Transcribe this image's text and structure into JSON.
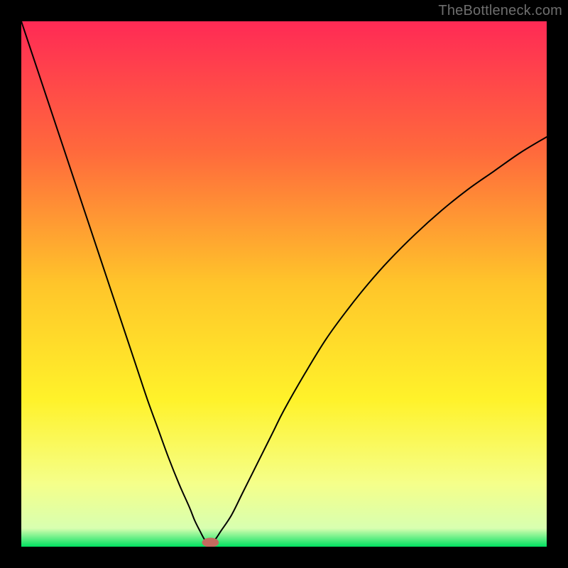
{
  "watermark": "TheBottleneck.com",
  "chart_data": {
    "type": "line",
    "title": "",
    "xlabel": "",
    "ylabel": "",
    "xlim": [
      0,
      100
    ],
    "ylim": [
      0,
      100
    ],
    "grid": false,
    "legend": false,
    "background_gradient": {
      "stops": [
        {
          "offset": 0.0,
          "color": "#ff2a55"
        },
        {
          "offset": 0.25,
          "color": "#ff6a3c"
        },
        {
          "offset": 0.5,
          "color": "#ffc52a"
        },
        {
          "offset": 0.72,
          "color": "#fff22a"
        },
        {
          "offset": 0.88,
          "color": "#f5ff8a"
        },
        {
          "offset": 0.965,
          "color": "#d8ffb0"
        },
        {
          "offset": 1.0,
          "color": "#00e060"
        }
      ]
    },
    "series": [
      {
        "name": "left-branch",
        "x": [
          0,
          2,
          4,
          6,
          8,
          10,
          12,
          14,
          16,
          18,
          20,
          22,
          24,
          26,
          28,
          30,
          32,
          33,
          34,
          35,
          36
        ],
        "values": [
          100,
          94,
          88,
          82,
          76,
          70,
          64,
          58,
          52,
          46,
          40,
          34,
          28,
          22.5,
          17,
          12,
          7.5,
          5,
          3,
          1.2,
          0.5
        ]
      },
      {
        "name": "right-branch",
        "x": [
          36,
          37,
          38,
          40,
          42,
          44,
          46,
          48,
          50,
          54,
          58,
          62,
          66,
          70,
          75,
          80,
          85,
          90,
          95,
          100
        ],
        "values": [
          0.5,
          1.5,
          3,
          6,
          10,
          14,
          18,
          22,
          26,
          33,
          39.5,
          45,
          50,
          54.5,
          59.5,
          64,
          68,
          71.5,
          75,
          78
        ]
      }
    ],
    "marker": {
      "name": "minimum-marker",
      "cx": 36,
      "cy": 0.8,
      "rx": 1.6,
      "ry": 0.9,
      "color": "#c46a5f"
    }
  }
}
